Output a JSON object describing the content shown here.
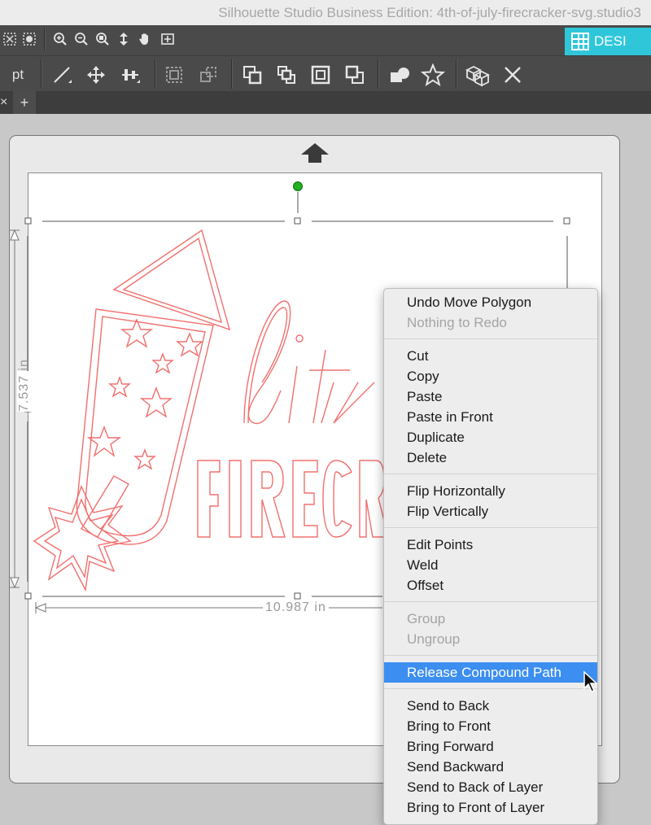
{
  "window": {
    "title": "Silhouette Studio Business Edition: 4th-of-july-firecracker-svg.studio3"
  },
  "toolbar": {
    "units_label": "pt",
    "design_tab_label": "DESI"
  },
  "document_tabs": {
    "close_glyph": "×",
    "add_glyph": "+"
  },
  "artwork": {
    "word1": "lit",
    "word2": "FIRECR",
    "stroke_color": "#f0706e"
  },
  "dimensions": {
    "width": "10.987 in",
    "height": "7.537 in"
  },
  "context_menu": {
    "groups": [
      [
        {
          "label": "Undo Move Polygon",
          "enabled": true
        },
        {
          "label": "Nothing to Redo",
          "enabled": false
        }
      ],
      [
        {
          "label": "Cut",
          "enabled": true
        },
        {
          "label": "Copy",
          "enabled": true
        },
        {
          "label": "Paste",
          "enabled": true
        },
        {
          "label": "Paste in Front",
          "enabled": true
        },
        {
          "label": "Duplicate",
          "enabled": true
        },
        {
          "label": "Delete",
          "enabled": true
        }
      ],
      [
        {
          "label": "Flip Horizontally",
          "enabled": true
        },
        {
          "label": "Flip Vertically",
          "enabled": true
        }
      ],
      [
        {
          "label": "Edit Points",
          "enabled": true
        },
        {
          "label": "Weld",
          "enabled": true
        },
        {
          "label": "Offset",
          "enabled": true
        }
      ],
      [
        {
          "label": "Group",
          "enabled": false
        },
        {
          "label": "Ungroup",
          "enabled": false
        }
      ],
      [
        {
          "label": "Release Compound Path",
          "enabled": true,
          "highlighted": true
        }
      ],
      [
        {
          "label": "Send to Back",
          "enabled": true
        },
        {
          "label": "Bring to Front",
          "enabled": true
        },
        {
          "label": "Bring Forward",
          "enabled": true
        },
        {
          "label": "Send Backward",
          "enabled": true
        },
        {
          "label": "Send to Back of Layer",
          "enabled": true
        },
        {
          "label": "Bring to Front of Layer",
          "enabled": true
        }
      ]
    ],
    "highlight_color": "#3c8ef0"
  }
}
